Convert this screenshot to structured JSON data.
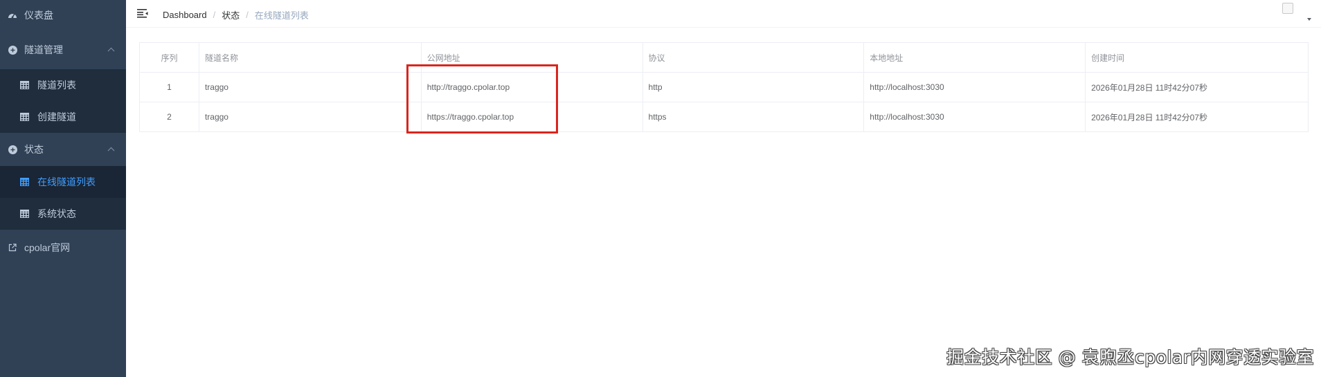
{
  "sidebar": {
    "dashboard": "仪表盘",
    "tunnel_mgmt": "隧道管理",
    "tunnel_list": "隧道列表",
    "create_tunnel": "创建隧道",
    "status": "状态",
    "online_tunnels": "在线隧道列表",
    "system_status": "系统状态",
    "cpolar_site": "cpolar官网"
  },
  "breadcrumb": [
    "Dashboard",
    "状态",
    "在线隧道列表"
  ],
  "table": {
    "headers": [
      "序列",
      "隧道名称",
      "公网地址",
      "协议",
      "本地地址",
      "创建时间"
    ],
    "rows": [
      [
        "1",
        "traggo",
        "http://traggo.cpolar.top",
        "http",
        "http://localhost:3030",
        "2026年01月28日 11时42分07秒"
      ],
      [
        "2",
        "traggo",
        "https://traggo.cpolar.top",
        "https",
        "http://localhost:3030",
        "2026年01月28日 11时42分07秒"
      ]
    ]
  },
  "watermark": "掘金技术社区 @ 袁煦丞cpolar内网穿透实验室",
  "colors": {
    "sidebar_bg": "#304156",
    "active": "#409eff",
    "highlight": "#d9251d"
  }
}
